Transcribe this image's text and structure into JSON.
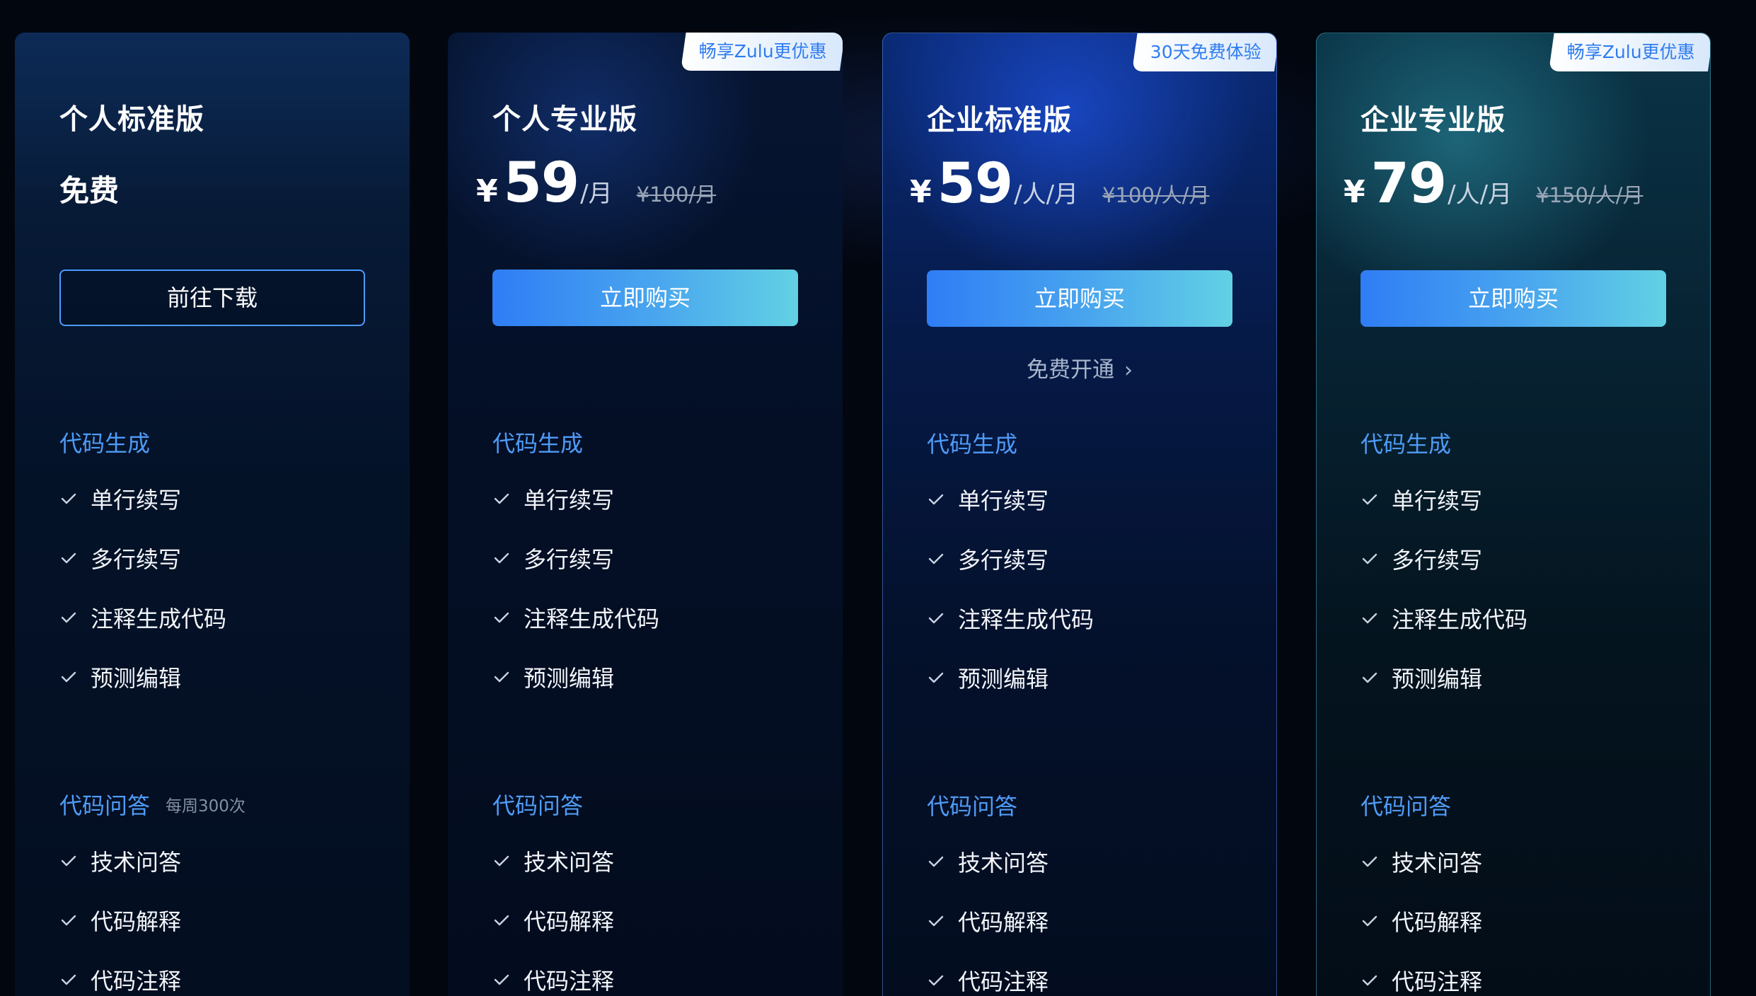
{
  "plans": [
    {
      "name": "个人标准版",
      "badge": "",
      "price_text": "免费",
      "button": "前往下载",
      "section1_title": "代码生成",
      "section1_items": [
        "单行续写",
        "多行续写",
        "注释生成代码",
        "预测编辑"
      ],
      "section2_title": "代码问答",
      "section2_note": "每周300次",
      "section2_items": [
        "技术问答",
        "代码解释",
        "代码注释"
      ]
    },
    {
      "name": "个人专业版",
      "badge": "畅享Zulu更优惠",
      "currency": "¥",
      "amount": "59",
      "unit": "/月",
      "original": "¥100/月",
      "button": "立即购买",
      "section1_title": "代码生成",
      "section1_items": [
        "单行续写",
        "多行续写",
        "注释生成代码",
        "预测编辑"
      ],
      "section2_title": "代码问答",
      "section2_items": [
        "技术问答",
        "代码解释",
        "代码注释"
      ]
    },
    {
      "name": "企业标准版",
      "badge": "30天免费体验",
      "currency": "¥",
      "amount": "59",
      "unit": "/人/月",
      "original": "¥100/人/月",
      "button": "立即购买",
      "free_link": "免费开通",
      "section1_title": "代码生成",
      "section1_items": [
        "单行续写",
        "多行续写",
        "注释生成代码",
        "预测编辑"
      ],
      "section2_title": "代码问答",
      "section2_items": [
        "技术问答",
        "代码解释",
        "代码注释"
      ]
    },
    {
      "name": "企业专业版",
      "badge": "畅享Zulu更优惠",
      "currency": "¥",
      "amount": "79",
      "unit": "/人/月",
      "original": "¥150/人/月",
      "button": "立即购买",
      "section1_title": "代码生成",
      "section1_items": [
        "单行续写",
        "多行续写",
        "注释生成代码",
        "预测编辑"
      ],
      "section2_title": "代码问答",
      "section2_items": [
        "技术问答",
        "代码解释",
        "代码注释"
      ]
    }
  ],
  "icons": {
    "check": "check-icon",
    "chevron": "chevron-right-icon"
  },
  "colors": {
    "accent_blue": "#4f9bf6",
    "button_gradient_start": "#2f7df5",
    "button_gradient_end": "#62d1e4",
    "badge_text": "#2f7cf0",
    "background": "#02060f"
  }
}
